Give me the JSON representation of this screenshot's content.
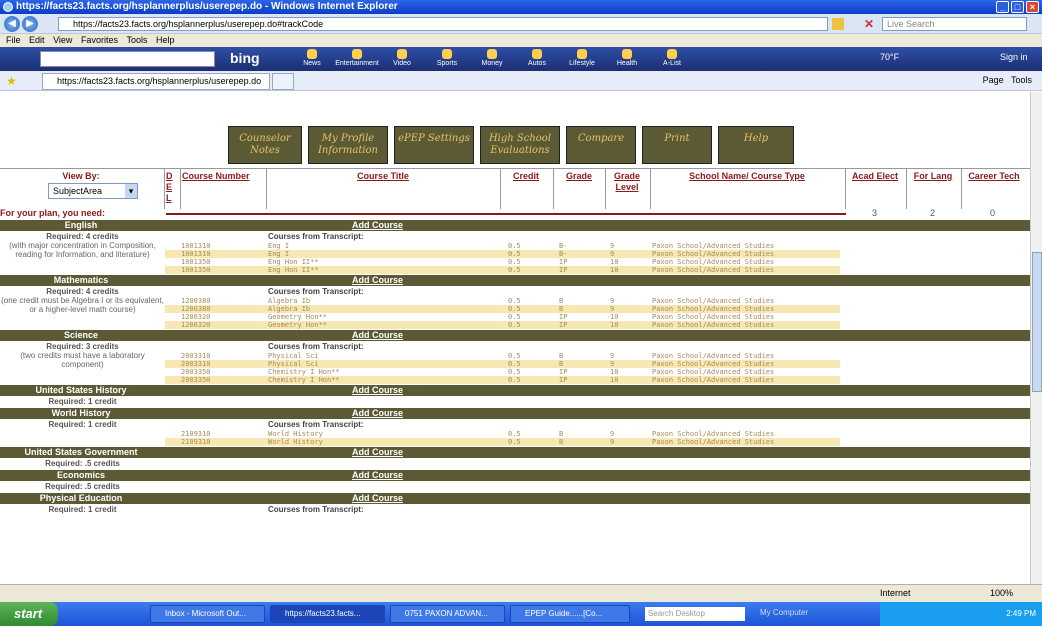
{
  "window": {
    "title": "https://facts23.facts.org/hsplannerplus/userepep.do - Windows Internet Explorer"
  },
  "address": {
    "url": "https://facts23.facts.org/hsplannerplus/userepep.do#trackCode",
    "search_placeholder": "Live Search"
  },
  "menu": [
    "File",
    "Edit",
    "View",
    "Favorites",
    "Tools",
    "Help"
  ],
  "msn": {
    "brand": "bing",
    "items": [
      "News",
      "Entertainment",
      "Video",
      "Sports",
      "Money",
      "Autos",
      "Lifestyle",
      "Health",
      "A-List"
    ],
    "temp": "70°F",
    "signin": "Sign in"
  },
  "tab": {
    "title": "https://facts23.facts.org/hsplannerplus/userepep.do"
  },
  "tools": {
    "page": "Page",
    "tools": "Tools"
  },
  "nav_tabs": [
    "Counselor Notes",
    "My Profile Information",
    "ePEP Settings",
    "High School Evaluations",
    "Compare",
    "Print",
    "Help"
  ],
  "headers": {
    "view_by": "View By:",
    "view_value": "SubjectArea",
    "del": "D E L",
    "course_number": "Course Number",
    "course_title": "Course Title",
    "credit": "Credit",
    "grade": "Grade",
    "grade_level": "Grade Level",
    "school": "School Name/ Course Type",
    "acad_elect": "Acad Elect",
    "for_lang": "For Lang",
    "career_tech": "Career Tech"
  },
  "need": {
    "label": "For your plan, you need:",
    "acad_elect": "3",
    "for_lang": "2",
    "career_tech": "0"
  },
  "add_course": "Add Course",
  "cft": "Courses from Transcript:",
  "subjects": [
    {
      "name": "English",
      "req": "Required: 4 credits",
      "note": "(with major concentration in Composition, reading for Information, and literature)",
      "rows": [
        [
          "1001310",
          "Eng I",
          "0.5",
          "B-",
          "9",
          "Paxon School/Advanced Studies"
        ],
        [
          "1001310",
          "Eng I",
          "0.5",
          "B-",
          "9",
          "Paxon School/Advanced Studies"
        ],
        [
          "1001350",
          "Eng Hon II**",
          "0.5",
          "IP",
          "10",
          "Paxon School/Advanced Studies"
        ],
        [
          "1001350",
          "Eng Hon II**",
          "0.5",
          "IP",
          "10",
          "Paxon School/Advanced Studies"
        ]
      ]
    },
    {
      "name": "Mathematics",
      "req": "Required: 4 credits",
      "note": "(one credit must be Algebra I or its equivalent, or a higher-level math course)",
      "rows": [
        [
          "1200380",
          "Algebra Ib",
          "0.5",
          "B",
          "9",
          "Paxon School/Advanced Studies"
        ],
        [
          "1200380",
          "Algebra Ib",
          "0.5",
          "B",
          "9",
          "Paxon School/Advanced Studies"
        ],
        [
          "1206320",
          "Geometry Hon**",
          "0.5",
          "IP",
          "10",
          "Paxon School/Advanced Studies"
        ],
        [
          "1206320",
          "Geometry Hon**",
          "0.5",
          "IP",
          "10",
          "Paxon School/Advanced Studies"
        ]
      ]
    },
    {
      "name": "Science",
      "req": "Required: 3 credits",
      "note": "(two credits must have a laboratory component)",
      "rows": [
        [
          "2003310",
          "Physical Sci",
          "0.5",
          "B",
          "9",
          "Paxon School/Advanced Studies"
        ],
        [
          "2003310",
          "Physical Sci",
          "0.5",
          "B",
          "9",
          "Paxon School/Advanced Studies"
        ],
        [
          "2003350",
          "Chemistry I Hon**",
          "0.5",
          "IP",
          "10",
          "Paxon School/Advanced Studies"
        ],
        [
          "2003350",
          "Chemistry I Hon**",
          "0.5",
          "IP",
          "10",
          "Paxon School/Advanced Studies"
        ]
      ]
    },
    {
      "name": "United States History",
      "req": "Required: 1 credit",
      "note": "",
      "rows": []
    },
    {
      "name": "World History",
      "req": "Required: 1 credit",
      "note": "",
      "rows": [
        [
          "2109310",
          "World History",
          "0.5",
          "B",
          "9",
          "Paxon School/Advanced Studies"
        ],
        [
          "2109310",
          "World History",
          "0.5",
          "B",
          "9",
          "Paxon School/Advanced Studies"
        ]
      ]
    },
    {
      "name": "United States Government",
      "req": "Required: .5 credits",
      "note": "",
      "rows": []
    },
    {
      "name": "Economics",
      "req": "Required: .5 credits",
      "note": "",
      "rows": []
    },
    {
      "name": "Physical Education",
      "req": "Required: 1 credit",
      "note": "",
      "rows": [],
      "cft": true
    }
  ],
  "status": {
    "zone": "Internet",
    "zoom": "100%"
  },
  "taskbar": {
    "start": "start",
    "tasks": [
      "Inbox - Microsoft Out...",
      "https://facts23.facts...",
      "0751 PAXON ADVAN...",
      "EPEP Guide......[Co..."
    ],
    "search": "Search Desktop",
    "mycomp": "My Computer",
    "clock": "2:49 PM"
  }
}
